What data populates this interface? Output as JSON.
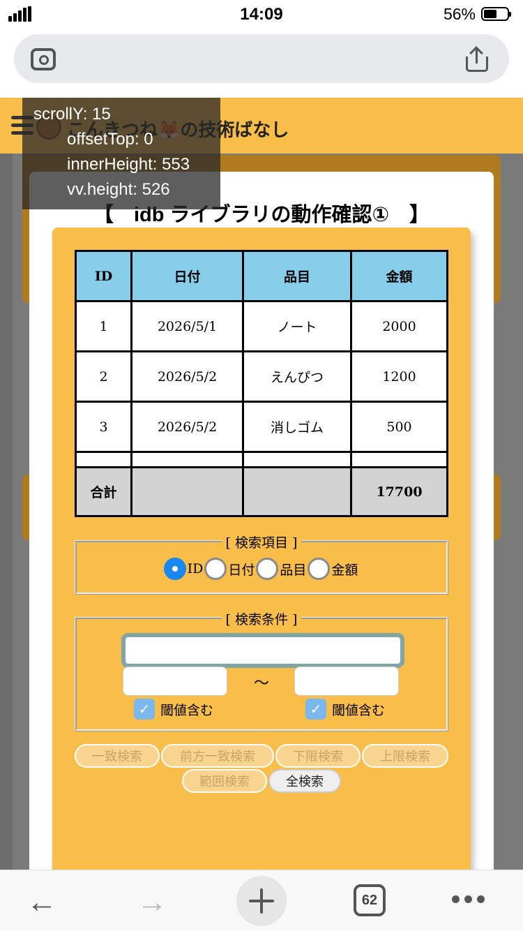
{
  "status_bar": {
    "time": "14:09",
    "battery": "56%"
  },
  "site": {
    "title": "こんきつね🦊の技術ばなし"
  },
  "page": {
    "heading": "【　idb ライブラリの動作確認①　】"
  },
  "table": {
    "headers": [
      "ID",
      "日付",
      "品目",
      "金額"
    ],
    "rows": [
      [
        "1",
        "2026/5/1",
        "ノート",
        "2000"
      ],
      [
        "2",
        "2026/5/2",
        "えんぴつ",
        "1200"
      ],
      [
        "3",
        "2026/5/2",
        "消しゴム",
        "500"
      ]
    ],
    "total": {
      "label": "合計",
      "amount": "17700"
    }
  },
  "search_field": {
    "legend": "[ 検索項目 ]",
    "options": [
      "ID",
      "日付",
      "品目",
      "金額"
    ],
    "selected": "ID"
  },
  "search_condition": {
    "legend": "[ 検索条件 ]",
    "main_value": "",
    "range_from": "",
    "range_to": "",
    "separator": "〜",
    "threshold_label": "閾値含む"
  },
  "buttons": [
    "一致検索",
    "前方一致検索",
    "下限検索",
    "上限検索",
    "範囲検索",
    "全検索"
  ],
  "debug": {
    "scroll_y": "scrollY: 15",
    "offset_top": "offsetTop: 0",
    "inner_height": "innerHeight: 553",
    "vv_height": "vv.height: 526"
  },
  "toolbar": {
    "tab_count": "62"
  }
}
